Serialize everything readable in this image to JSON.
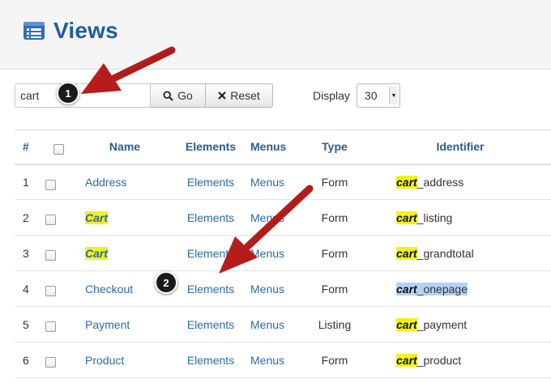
{
  "header": {
    "title": "Views",
    "icon": "list-icon"
  },
  "toolbar": {
    "search_value": "cart",
    "go_label": "Go",
    "reset_label": "Reset",
    "display_label": "Display",
    "display_value": "30"
  },
  "table": {
    "headers": {
      "num": "#",
      "name": "Name",
      "elements": "Elements",
      "menus": "Menus",
      "type": "Type",
      "identifier": "Identifier"
    },
    "rows": [
      {
        "num": "1",
        "name": "Address",
        "elements": "Elements",
        "menus": "Menus",
        "type": "Form",
        "ident_hl": "cart",
        "ident_rest": "_address"
      },
      {
        "num": "2",
        "name": "Cart",
        "elements": "Elements",
        "menus": "Menus",
        "type": "Form",
        "ident_hl": "cart",
        "ident_rest": "_listing"
      },
      {
        "num": "3",
        "name": "Cart",
        "elements": "Elements",
        "menus": "Menus",
        "type": "Form",
        "ident_hl": "cart",
        "ident_rest": "_grandtotal"
      },
      {
        "num": "4",
        "name": "Checkout",
        "elements": "Elements",
        "menus": "Menus",
        "type": "Form",
        "ident_hl": "cart",
        "ident_rest": "_onepage"
      },
      {
        "num": "5",
        "name": "Payment",
        "elements": "Elements",
        "menus": "Menus",
        "type": "Listing",
        "ident_hl": "cart",
        "ident_rest": "_payment"
      },
      {
        "num": "6",
        "name": "Product",
        "elements": "Elements",
        "menus": "Menus",
        "type": "Form",
        "ident_hl": "cart",
        "ident_rest": "_product"
      }
    ]
  },
  "annotations": {
    "marker_1": "1",
    "marker_2": "2"
  },
  "colors": {
    "accent": "#1f5e9c",
    "link": "#2a6aa8",
    "highlight": "#f2f21a",
    "selection": "#b3d3f5",
    "arrow": "#b71c1c"
  }
}
